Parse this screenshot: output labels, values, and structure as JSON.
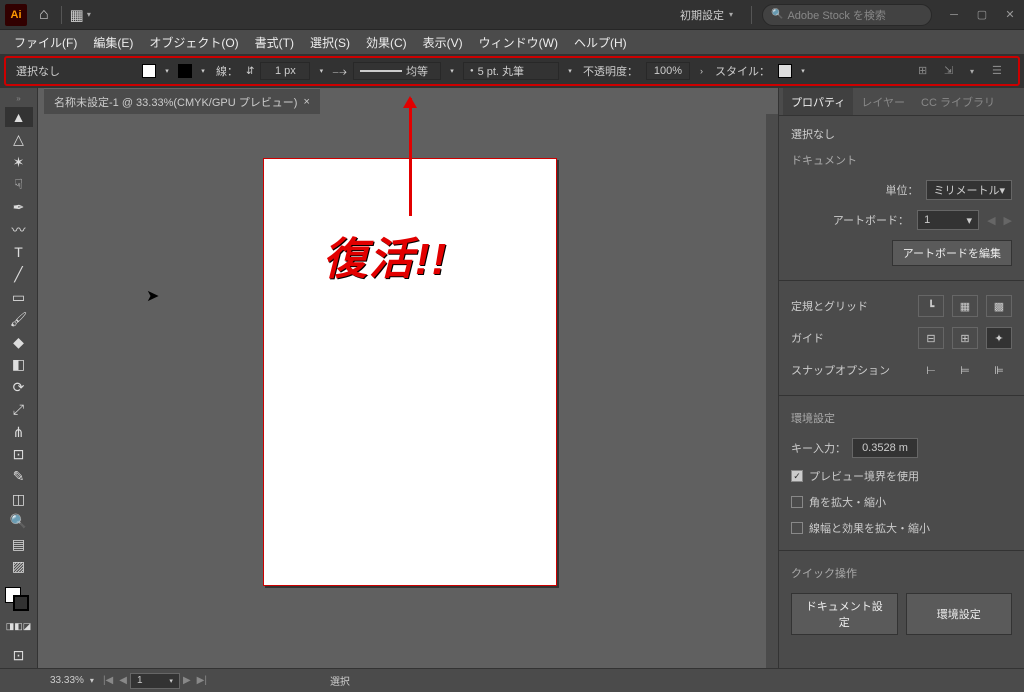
{
  "titlebar": {
    "workspace": "初期設定",
    "search_placeholder": "Adobe Stock を検索"
  },
  "menu": {
    "file": "ファイル(F)",
    "edit": "編集(E)",
    "object": "オブジェクト(O)",
    "type": "書式(T)",
    "select": "選択(S)",
    "effect": "効果(C)",
    "view": "表示(V)",
    "window": "ウィンドウ(W)",
    "help": "ヘルプ(H)"
  },
  "ctrl": {
    "selection": "選択なし",
    "stroke_label": "線：",
    "stroke_width": "1 px",
    "stroke_type": "均等",
    "brush": "5 pt. 丸筆",
    "opacity_label": "不透明度：",
    "opacity": "100%",
    "style_label": "スタイル："
  },
  "doc": {
    "tab": "名称未設定-1 @ 33.33%(CMYK/GPU プレビュー)",
    "artboard_text": "復活!!"
  },
  "panel": {
    "tab_prop": "プロパティ",
    "tab_layer": "レイヤー",
    "tab_cc": "CC ライブラリ",
    "sel_none": "選択なし",
    "doc_sec": "ドキュメント",
    "unit_label": "単位：",
    "unit": "ミリメートル",
    "artboard_label": "アートボード：",
    "artboard": "1",
    "edit_artboards": "アートボードを編集",
    "ruler_grid": "定規とグリッド",
    "guide": "ガイド",
    "snap": "スナップオプション",
    "prefs": "環境設定",
    "key_label": "キー入力：",
    "key_val": "0.3528 m",
    "cb1": "プレビュー境界を使用",
    "cb2": "角を拡大・縮小",
    "cb3": "線幅と効果を拡大・縮小",
    "quick": "クイック操作",
    "btn_doc": "ドキュメント設定",
    "btn_pref": "環境設定"
  },
  "status": {
    "zoom": "33.33%",
    "nav": "1",
    "tool": "選択"
  }
}
